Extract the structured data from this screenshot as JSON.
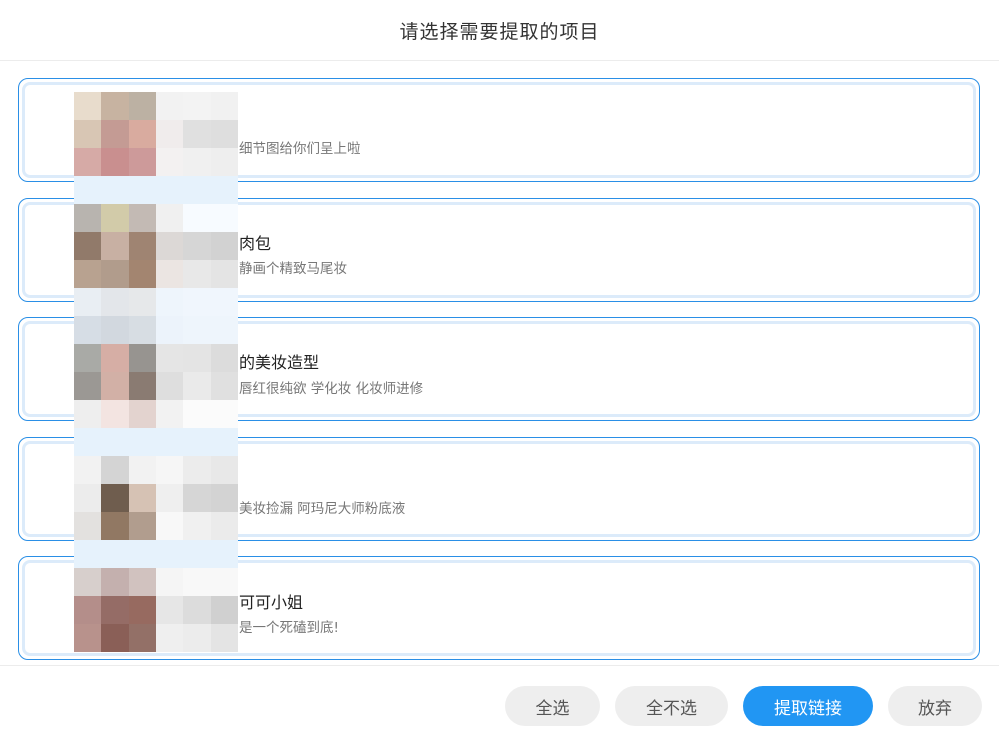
{
  "dialog": {
    "title": "请选择需要提取的项目"
  },
  "items": [
    {
      "title": "",
      "desc": "细节图给你们呈上啦"
    },
    {
      "title": "肉包",
      "desc": "静画个精致马尾妆"
    },
    {
      "title": "的美妆造型",
      "desc": "唇红很纯欲 学化妆 化妆师进修"
    },
    {
      "title": "",
      "desc": "美妆捡漏 阿玛尼大师粉底液"
    },
    {
      "title": "可可小姐",
      "desc": "是一个死磕到底!"
    }
  ],
  "footer": {
    "select_all": "全选",
    "select_none": "全不选",
    "extract_links": "提取链接",
    "discard": "放弃"
  },
  "colors": {
    "accent": "#2196f3",
    "item_border": "#2a8fe6",
    "button_gray": "#eeeeee"
  }
}
